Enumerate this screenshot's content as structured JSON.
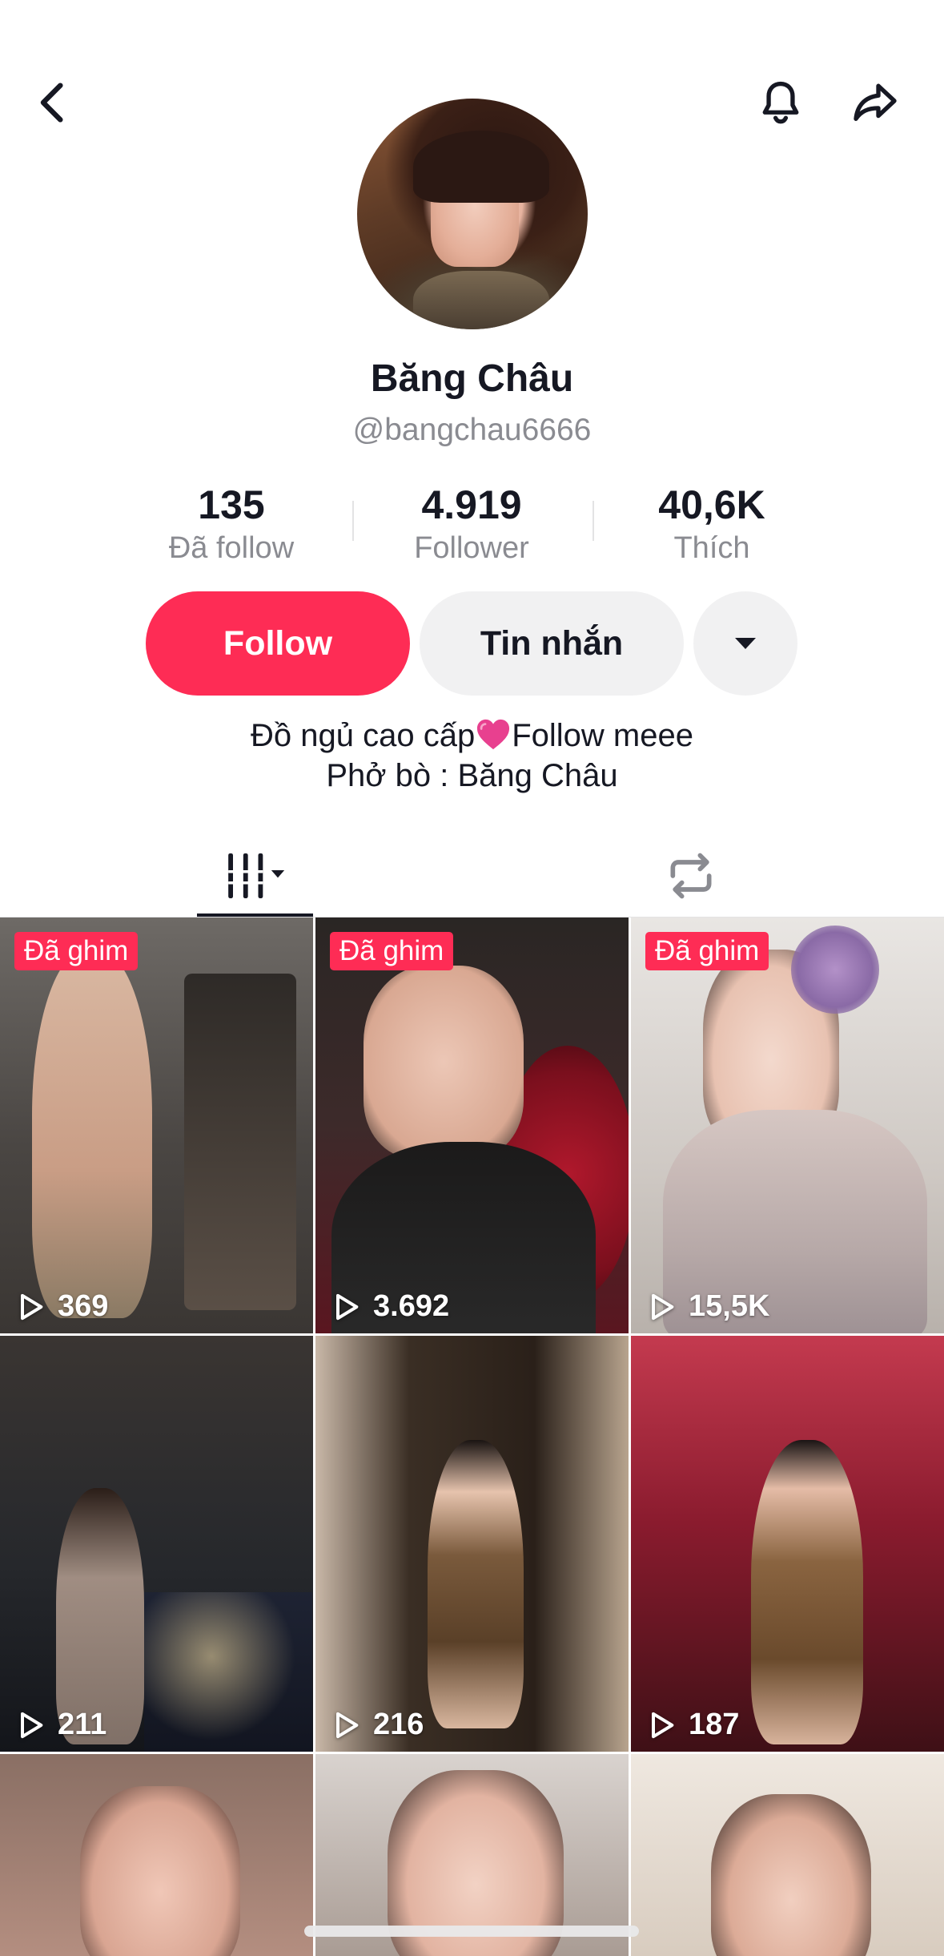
{
  "profile": {
    "name": "Băng Châu",
    "handle": "@bangchau6666"
  },
  "stats": [
    {
      "value": "135",
      "label": "Đã follow"
    },
    {
      "value": "4.919",
      "label": "Follower"
    },
    {
      "value": "40,6K",
      "label": "Thích"
    }
  ],
  "actions": {
    "follow_label": "Follow",
    "message_label": "Tin nhắn"
  },
  "bio": {
    "line1_part1": "Đồ ngủ cao cấp",
    "line1_part2": "Follow meee",
    "line2": "Phở bò : Băng Châu"
  },
  "colors": {
    "accent": "#fe2c55",
    "text": "#161823",
    "muted": "#8a8b91",
    "button_bg": "#f1f1f2"
  },
  "icons": {
    "back": "chevron-left-icon",
    "notification": "bell-icon",
    "share": "share-arrow-icon",
    "videos_tab": "grid-bars-icon",
    "reposts_tab": "repost-icon",
    "play": "play-outline-icon"
  },
  "videos": [
    {
      "pinned_label": "Đã ghim",
      "views": "369"
    },
    {
      "pinned_label": "Đã ghim",
      "views": "3.692"
    },
    {
      "pinned_label": "Đã ghim",
      "views": "15,5K"
    },
    {
      "views": "211"
    },
    {
      "views": "216"
    },
    {
      "views": "187"
    },
    {
      "views": ""
    },
    {
      "views": ""
    },
    {
      "views": ""
    }
  ]
}
